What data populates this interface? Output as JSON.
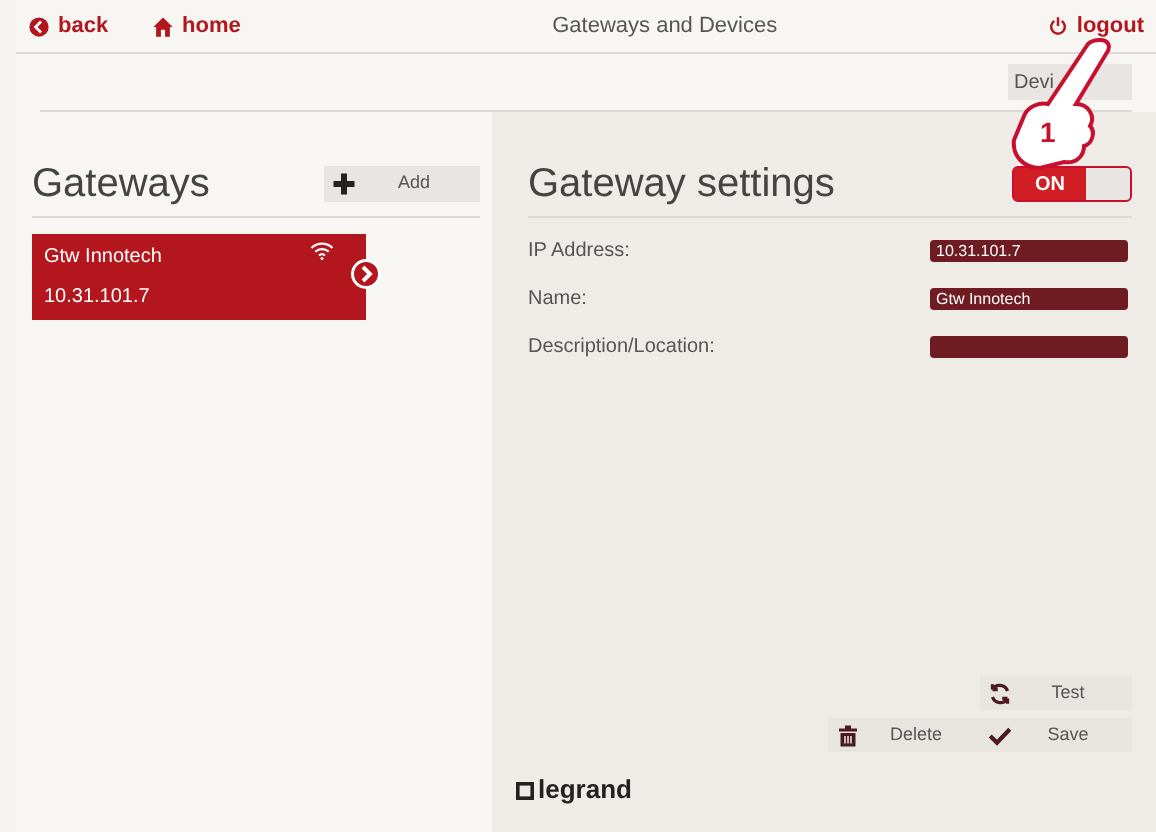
{
  "top_bar": {
    "back": "back",
    "home": "home",
    "title": "Gateways and Devices",
    "logout": "logout"
  },
  "breadcrumb": {
    "label": "Devi"
  },
  "gateways": {
    "title": "Gateways",
    "add_label": "Add",
    "items": [
      {
        "name": "Gtw Innotech",
        "ip": "10.31.101.7",
        "selected": true
      }
    ]
  },
  "settings": {
    "title": "Gateway settings",
    "enabled": true,
    "enabled_label": "ON",
    "fields": [
      {
        "label": "IP Address:",
        "value": "10.31.101.7"
      },
      {
        "label": "Name:",
        "value": "Gtw Innotech"
      },
      {
        "label": "Description/Location:"
      }
    ],
    "buttons": [
      {
        "kind": "test",
        "label": "Test"
      },
      {
        "kind": "delete",
        "label": "Delete"
      },
      {
        "kind": "save",
        "label": "Save"
      }
    ]
  },
  "brand": "legrand",
  "annotation": {
    "number": "1"
  }
}
